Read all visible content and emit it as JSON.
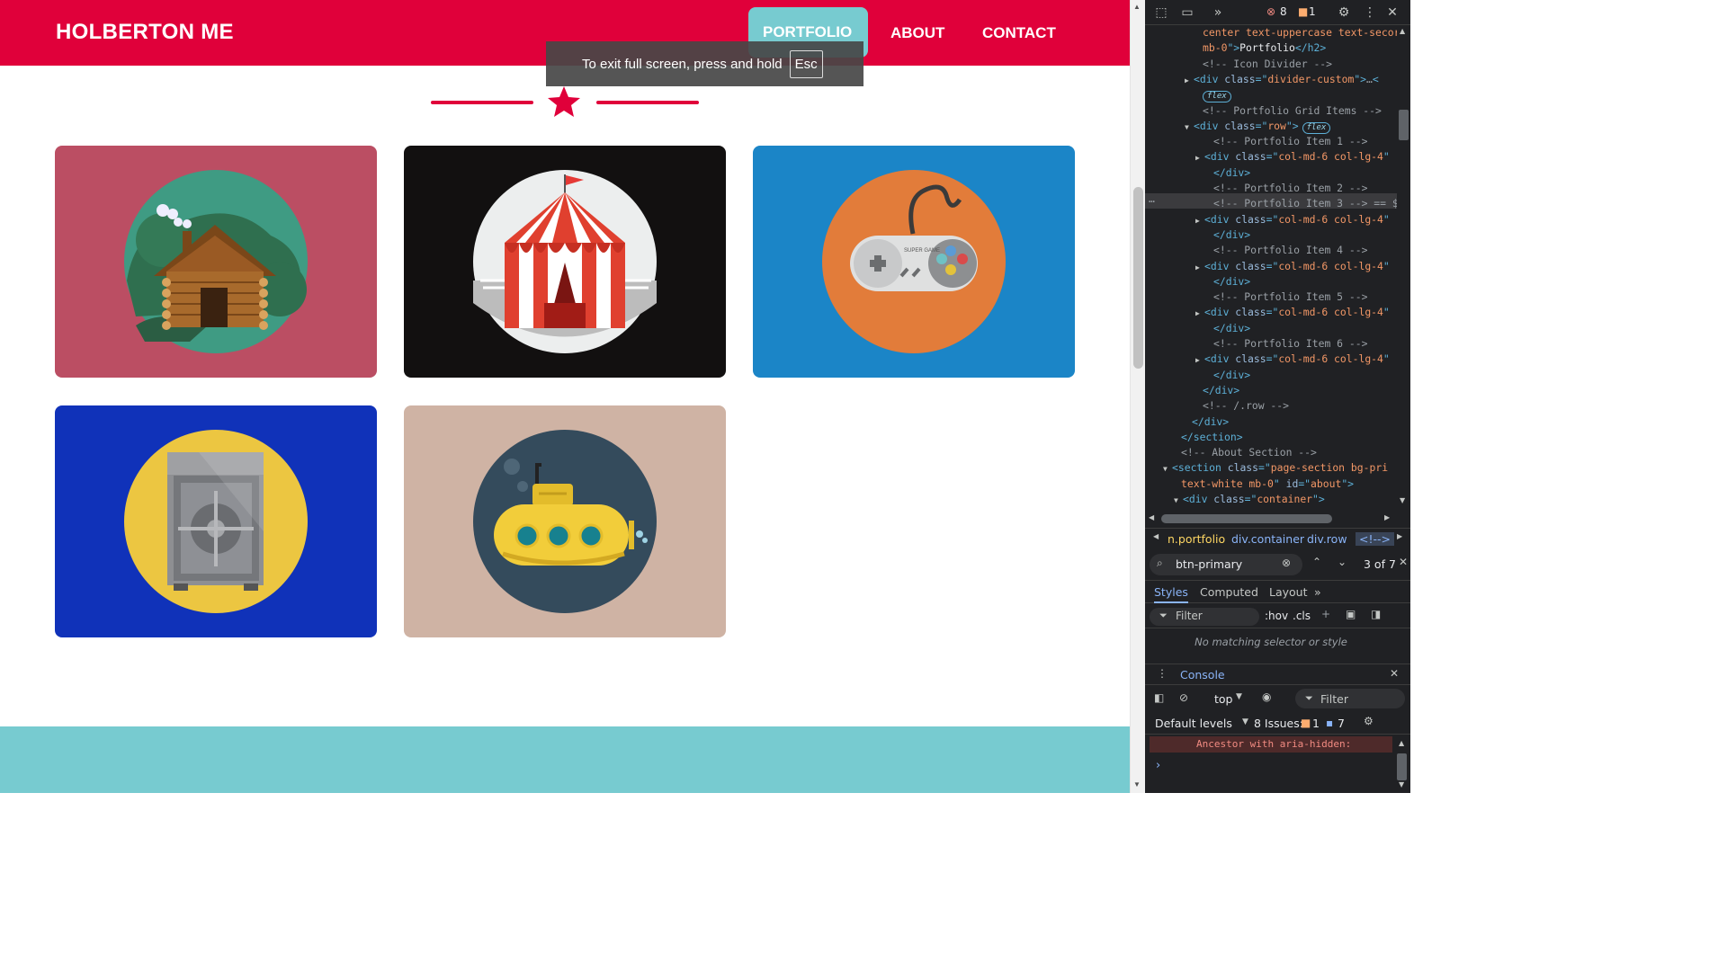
{
  "site": {
    "brand": "HOLBERTON ME",
    "nav": [
      {
        "label": "PORTFOLIO",
        "active": true
      },
      {
        "label": "ABOUT",
        "active": false
      },
      {
        "label": "CONTACT",
        "active": false
      }
    ],
    "fullscreen_toast": {
      "text": "To exit full screen, press and hold",
      "key": "Esc"
    },
    "colors": {
      "primary": "#e0003a",
      "secondary": "#77cbd0"
    },
    "portfolio_items": [
      {
        "icon": "cabin-icon",
        "bg": "#bb4e63"
      },
      {
        "icon": "circus-tent-icon",
        "bg": "#121010"
      },
      {
        "icon": "game-controller-icon",
        "bg": "#1b85c7"
      },
      {
        "icon": "safe-icon",
        "bg": "#1032b9"
      },
      {
        "icon": "submarine-icon",
        "bg": "#cfb3a4"
      }
    ],
    "controller_text": "SUPER GAME"
  },
  "devtools": {
    "error_count": "8",
    "warning_count": "1",
    "elements_lines": [
      {
        "indent": 64,
        "parts": [
          [
            "val",
            "center text-uppercase text-secor"
          ]
        ]
      },
      {
        "indent": 64,
        "parts": [
          [
            "val",
            "mb-0"
          ],
          [
            "tag",
            "\">"
          ],
          [
            "txt",
            "Portfolio"
          ],
          [
            "tag",
            "</h2>"
          ]
        ]
      },
      {
        "indent": 64,
        "parts": [
          [
            "cmt",
            "<!-- Icon Divider -->"
          ]
        ]
      },
      {
        "indent": 54,
        "tri": "▶",
        "parts": [
          [
            "tag",
            "<div "
          ],
          [
            "attr",
            "class"
          ],
          [
            "tag",
            "=\""
          ],
          [
            "val",
            "divider-custom"
          ],
          [
            "tag",
            "\">"
          ],
          [
            "cmt",
            "…"
          ],
          [
            "tag",
            "<"
          ]
        ]
      },
      {
        "indent": 64,
        "chip": "flex"
      },
      {
        "indent": 64,
        "parts": [
          [
            "cmt",
            "<!-- Portfolio Grid Items -->"
          ]
        ]
      },
      {
        "indent": 54,
        "tri": "▼",
        "parts": [
          [
            "tag",
            "<div "
          ],
          [
            "attr",
            "class"
          ],
          [
            "tag",
            "=\""
          ],
          [
            "val",
            "row"
          ],
          [
            "tag",
            "\">"
          ]
        ],
        "chip_inline": "flex"
      },
      {
        "indent": 76,
        "parts": [
          [
            "cmt",
            "<!-- Portfolio Item 1 -->"
          ]
        ]
      },
      {
        "indent": 66,
        "tri": "▶",
        "parts": [
          [
            "tag",
            "<div "
          ],
          [
            "attr",
            "class"
          ],
          [
            "tag",
            "=\""
          ],
          [
            "val",
            "col-md-6 col-lg-4"
          ],
          [
            "tag",
            "\""
          ]
        ]
      },
      {
        "indent": 76,
        "parts": [
          [
            "tag",
            "</div>"
          ]
        ]
      },
      {
        "indent": 76,
        "parts": [
          [
            "cmt",
            "<!-- Portfolio Item 2 -->"
          ]
        ]
      },
      {
        "indent": 76,
        "selected": true,
        "parts": [
          [
            "cmt",
            "<!-- Portfolio Item 3 --> == $"
          ]
        ]
      },
      {
        "indent": 66,
        "tri": "▶",
        "parts": [
          [
            "tag",
            "<div "
          ],
          [
            "attr",
            "class"
          ],
          [
            "tag",
            "=\""
          ],
          [
            "val",
            "col-md-6 col-lg-4"
          ],
          [
            "tag",
            "\""
          ]
        ]
      },
      {
        "indent": 76,
        "parts": [
          [
            "tag",
            "</div>"
          ]
        ]
      },
      {
        "indent": 76,
        "parts": [
          [
            "cmt",
            "<!-- Portfolio Item 4 -->"
          ]
        ]
      },
      {
        "indent": 66,
        "tri": "▶",
        "parts": [
          [
            "tag",
            "<div "
          ],
          [
            "attr",
            "class"
          ],
          [
            "tag",
            "=\""
          ],
          [
            "val",
            "col-md-6 col-lg-4"
          ],
          [
            "tag",
            "\""
          ]
        ]
      },
      {
        "indent": 76,
        "parts": [
          [
            "tag",
            "</div>"
          ]
        ]
      },
      {
        "indent": 76,
        "parts": [
          [
            "cmt",
            "<!-- Portfolio Item 5 -->"
          ]
        ]
      },
      {
        "indent": 66,
        "tri": "▶",
        "parts": [
          [
            "tag",
            "<div "
          ],
          [
            "attr",
            "class"
          ],
          [
            "tag",
            "=\""
          ],
          [
            "val",
            "col-md-6 col-lg-4"
          ],
          [
            "tag",
            "\""
          ]
        ]
      },
      {
        "indent": 76,
        "parts": [
          [
            "tag",
            "</div>"
          ]
        ]
      },
      {
        "indent": 76,
        "parts": [
          [
            "cmt",
            "<!-- Portfolio Item 6 -->"
          ]
        ]
      },
      {
        "indent": 66,
        "tri": "▶",
        "parts": [
          [
            "tag",
            "<div "
          ],
          [
            "attr",
            "class"
          ],
          [
            "tag",
            "=\""
          ],
          [
            "val",
            "col-md-6 col-lg-4"
          ],
          [
            "tag",
            "\""
          ]
        ]
      },
      {
        "indent": 76,
        "parts": [
          [
            "tag",
            "</div>"
          ]
        ]
      },
      {
        "indent": 64,
        "parts": [
          [
            "tag",
            "</div>"
          ]
        ]
      },
      {
        "indent": 64,
        "parts": [
          [
            "cmt",
            "<!-- /.row -->"
          ]
        ]
      },
      {
        "indent": 52,
        "parts": [
          [
            "tag",
            "</div>"
          ]
        ]
      },
      {
        "indent": 40,
        "parts": [
          [
            "tag",
            "</section>"
          ]
        ]
      },
      {
        "indent": 40,
        "parts": [
          [
            "cmt",
            "<!-- About Section -->"
          ]
        ]
      },
      {
        "indent": 30,
        "tri": "▼",
        "parts": [
          [
            "tag",
            "<section "
          ],
          [
            "attr",
            "class"
          ],
          [
            "tag",
            "=\""
          ],
          [
            "val",
            "page-section bg-pri"
          ]
        ]
      },
      {
        "indent": 40,
        "parts": [
          [
            "val",
            "text-white mb-0"
          ],
          [
            "tag",
            "\" "
          ],
          [
            "attr",
            "id"
          ],
          [
            "tag",
            "=\""
          ],
          [
            "val",
            "about"
          ],
          [
            "tag",
            "\">"
          ]
        ]
      },
      {
        "indent": 42,
        "tri": "▼",
        "parts": [
          [
            "tag",
            "<div "
          ],
          [
            "attr",
            "class"
          ],
          [
            "tag",
            "=\""
          ],
          [
            "val",
            "container"
          ],
          [
            "tag",
            "\">"
          ]
        ]
      }
    ],
    "breadcrumbs": [
      "n.portfolio",
      "div.container",
      "div.row",
      "<!-->"
    ],
    "search": {
      "value": "btn-primary",
      "match": "3 of 7"
    },
    "style_tabs": [
      "Styles",
      "Computed",
      "Layout"
    ],
    "filter_placeholder": "Filter",
    "hov": ":hov",
    "cls": ".cls",
    "no_match": "No matching selector or style",
    "console_title": "Console",
    "context": "top",
    "console_filter": "Filter",
    "levels": "Default levels",
    "issues_label": "8 Issues:",
    "issues_warn": "1",
    "issues_info": "7",
    "console_message": "Ancestor with aria-hidden:"
  }
}
